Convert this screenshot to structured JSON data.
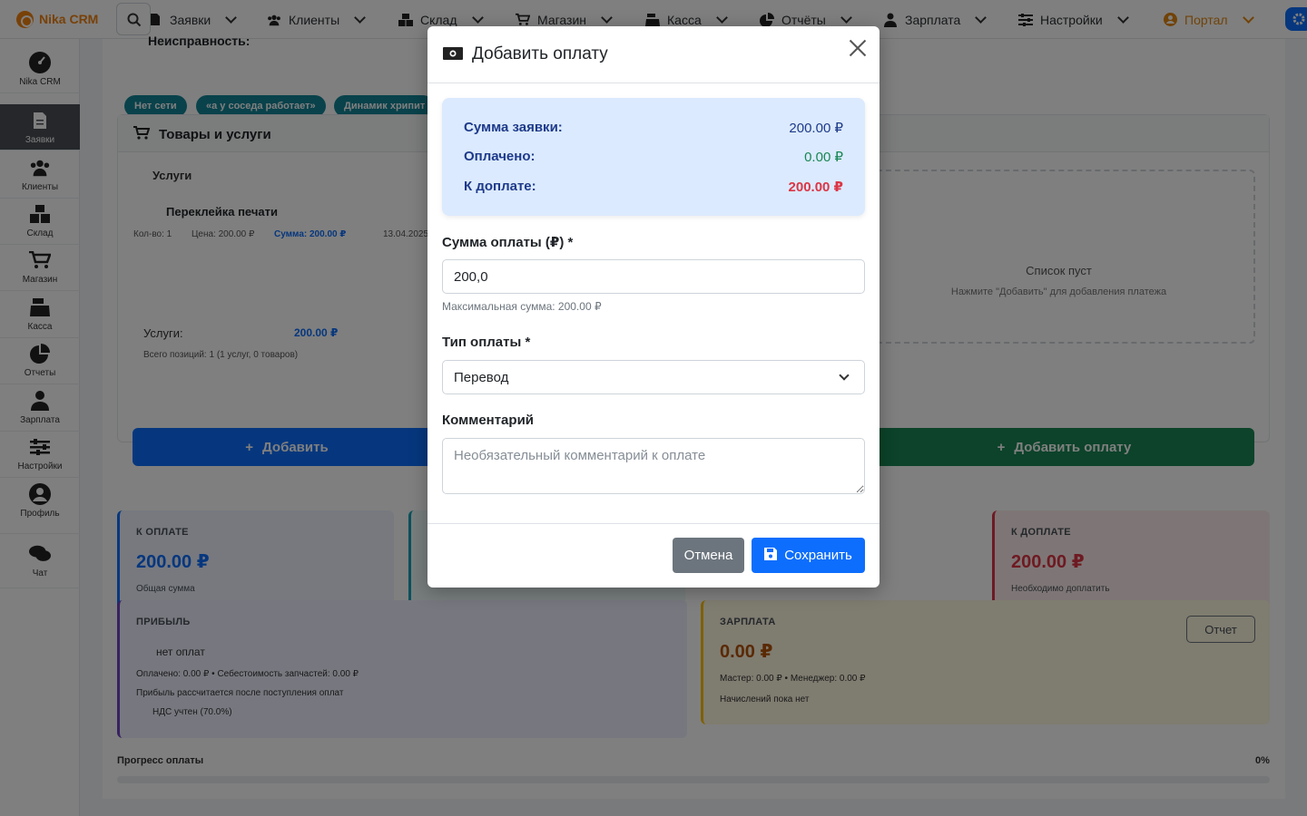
{
  "nav": {
    "brand": "Nika CRM",
    "items": [
      {
        "label": "Заявки"
      },
      {
        "label": "Клиенты"
      },
      {
        "label": "Склад"
      },
      {
        "label": "Магазин"
      },
      {
        "label": "Касса"
      },
      {
        "label": "Отчёты"
      },
      {
        "label": "Зарплата"
      },
      {
        "label": "Настройки"
      },
      {
        "label": "Портал"
      }
    ]
  },
  "sidebar": {
    "items": [
      {
        "label": "Nika CRM"
      },
      {
        "label": "Заявки"
      },
      {
        "label": "Клиенты"
      },
      {
        "label": "Склад"
      },
      {
        "label": "Магазин"
      },
      {
        "label": "Касса"
      },
      {
        "label": "Отчеты"
      },
      {
        "label": "Зарплата"
      },
      {
        "label": "Настройки"
      },
      {
        "label": "Профиль"
      },
      {
        "label": "Чат"
      }
    ]
  },
  "background": {
    "fault_title": "Неисправность:",
    "tags": [
      "Нет сети",
      "«а у соседа работает»",
      "Динамик хрипит"
    ],
    "goods_title": "Товары и услуги",
    "services_subtitle": "Услуги",
    "service_name": "Переклейка печати",
    "service_qty": "Кол-во: 1",
    "service_price": "Цена: 200.00 ₽",
    "service_sum": "Сумма: 200.00 ₽",
    "service_date": "13.04.2025",
    "totals_label": "Услуги:",
    "totals_value": "200.00 ₽",
    "totals_positions": "Всего позиций: 1 (1 услуг, 0 товаров)",
    "payments_empty": "Список пуст",
    "payments_hint": "Нажмите \"Добавить\" для добавления платежа",
    "add_service_button": "Добавить",
    "add_payment_button": "Добавить оплату",
    "stat_to_pay": {
      "label": "К оплате",
      "value": "200.00 ₽",
      "sub": "Общая сумма"
    },
    "stat_due": {
      "label": "К доплате",
      "value": "200.00 ₽",
      "sub": "Необходимо доплатить"
    },
    "profit": {
      "label": "Прибыль",
      "status": "нет оплат",
      "line1": "Оплачено: 0.00 ₽ • Себестоимость запчастей: 0.00 ₽",
      "line2": "Прибыль рассчитается после поступления оплат",
      "line3": "НДС учтен (70.0%)"
    },
    "salary": {
      "label": "Зарплата",
      "value": "0.00 ₽",
      "line1": "Мастер: 0.00 ₽ • Менеджер: 0.00 ₽",
      "line2": "Начислений пока нет",
      "report_button": "Отчет"
    },
    "progress_label": "Прогресс оплаты",
    "progress_value": "0%",
    "progress_fraction": 0
  },
  "modal": {
    "title": "Добавить оплату",
    "summary": [
      {
        "key": "Сумма заявки:",
        "value": "200.00 ₽",
        "color": "#1e3a8a"
      },
      {
        "key": "Оплачено:",
        "value": "0.00 ₽",
        "color": "#198754"
      },
      {
        "key": "К доплате:",
        "value": "200.00 ₽",
        "color": "#dc3545"
      }
    ],
    "amount_label": "Сумма оплаты (₽) *",
    "amount_value": "200,0",
    "amount_help": "Максимальная сумма: 200.00 ₽",
    "type_label": "Тип оплаты *",
    "type_value": "Перевод",
    "comment_label": "Комментарий",
    "comment_placeholder": "Необязательный комментарий к оплате",
    "cancel_button": "Отмена",
    "save_button": "Сохранить"
  },
  "colors": {
    "brand": "#f0820f",
    "primary": "#0d6efd",
    "success": "#198754",
    "danger": "#dc3545",
    "secondary": "#6c757d"
  }
}
